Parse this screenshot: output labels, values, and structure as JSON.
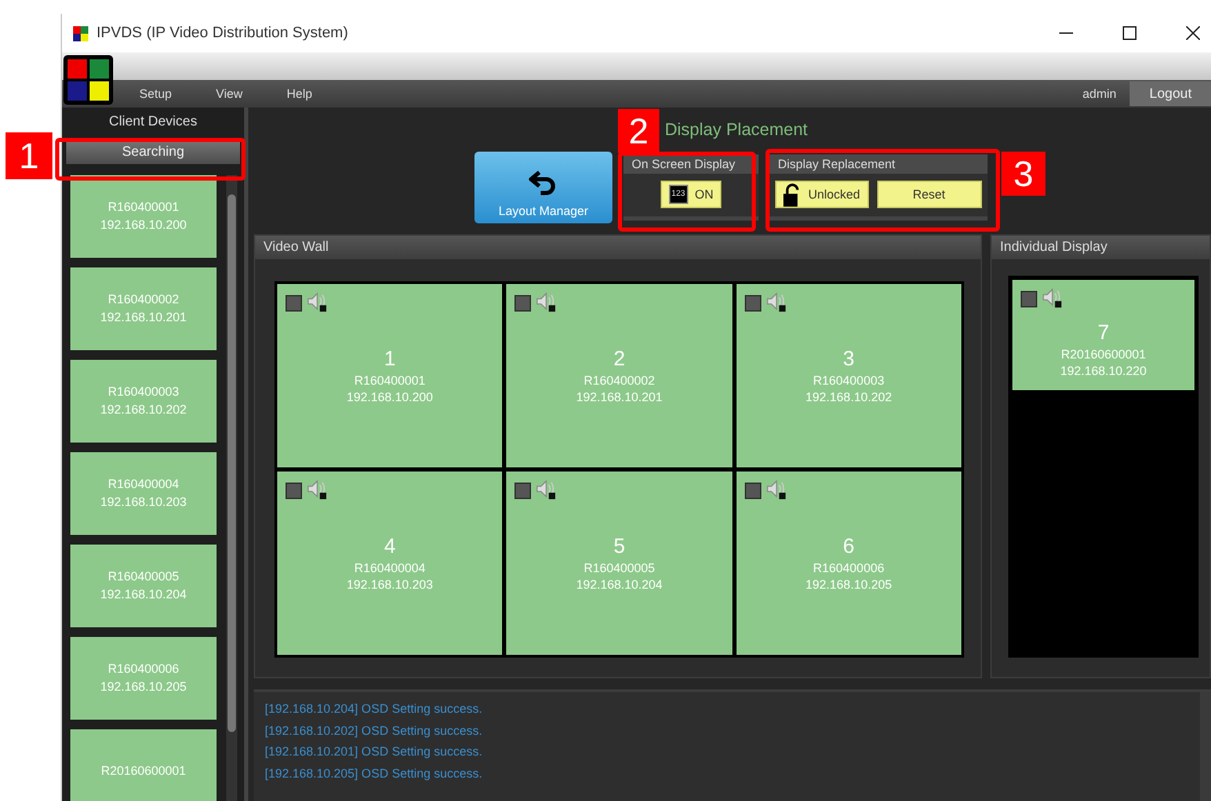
{
  "window": {
    "title": "IPVDS (IP Video Distribution System)"
  },
  "menu": [
    "Setup",
    "View",
    "Help"
  ],
  "user": "admin",
  "logout": "Logout",
  "sidebar": {
    "title": "Client Devices",
    "search_button": "Searching",
    "devices": [
      {
        "id": "R160400001",
        "ip": "192.168.10.200"
      },
      {
        "id": "R160400002",
        "ip": "192.168.10.201"
      },
      {
        "id": "R160400003",
        "ip": "192.168.10.202"
      },
      {
        "id": "R160400004",
        "ip": "192.168.10.203"
      },
      {
        "id": "R160400005",
        "ip": "192.168.10.204"
      },
      {
        "id": "R160400006",
        "ip": "192.168.10.205"
      },
      {
        "id": "R20160600001"
      }
    ]
  },
  "toolbar": {
    "title": "Display Placement",
    "layout_button": "Layout Manager",
    "osd": {
      "title": "On Screen Display",
      "icon_label": "123",
      "button": "ON"
    },
    "replacement": {
      "title": "Display Replacement",
      "lock_button": "Unlocked",
      "reset_button": "Reset"
    }
  },
  "video_wall": {
    "title": "Video Wall",
    "tiles": [
      {
        "number": "1",
        "id": "R160400001",
        "ip": "192.168.10.200",
        "checked": false
      },
      {
        "number": "2",
        "id": "R160400002",
        "ip": "192.168.10.201",
        "checked": false
      },
      {
        "number": "3",
        "id": "R160400003",
        "ip": "192.168.10.202",
        "checked": false
      },
      {
        "number": "4",
        "id": "R160400004",
        "ip": "192.168.10.203",
        "checked": false
      },
      {
        "number": "5",
        "id": "R160400005",
        "ip": "192.168.10.204",
        "checked": false
      },
      {
        "number": "6",
        "id": "R160400006",
        "ip": "192.168.10.205",
        "checked": false
      }
    ]
  },
  "individual_display": {
    "title": "Individual Display",
    "tiles": [
      {
        "number": "7",
        "id": "R20160600001",
        "ip": "192.168.10.220",
        "checked": false
      }
    ]
  },
  "log": [
    "[192.168.10.204] OSD Setting success.",
    "[192.168.10.202] OSD Setting success.",
    "[192.168.10.201] OSD Setting success.",
    "[192.168.10.205] OSD Setting success."
  ],
  "callouts": [
    "1",
    "2",
    "3"
  ]
}
